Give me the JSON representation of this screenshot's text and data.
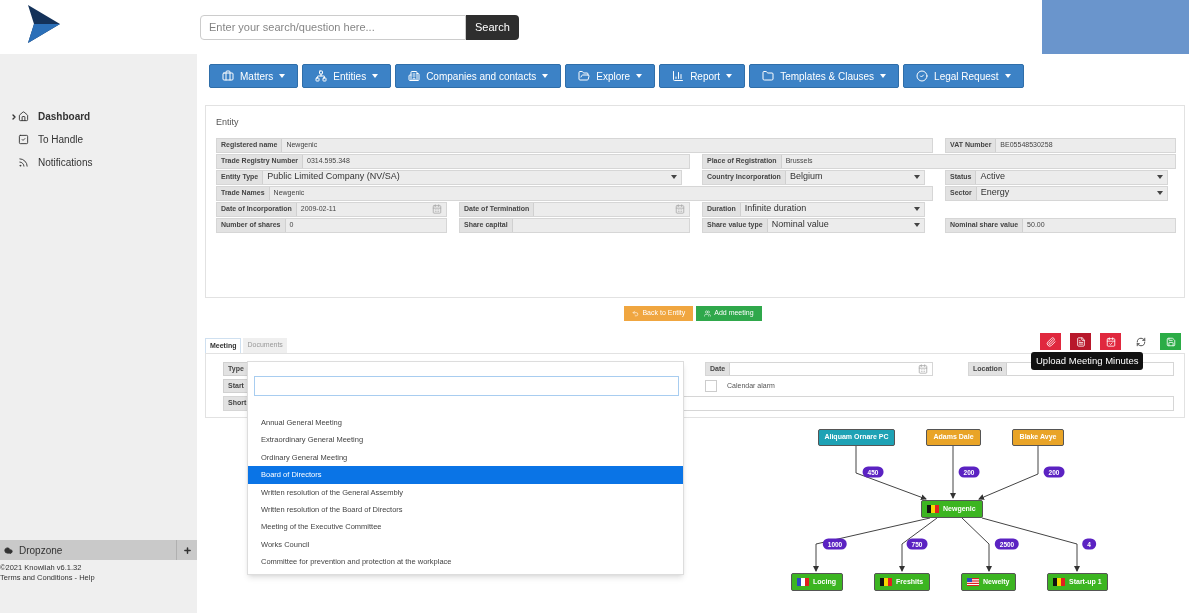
{
  "header": {
    "search": {
      "placeholder": "Enter your search/question here..."
    },
    "search_button": "Search"
  },
  "sidebar": {
    "items": [
      {
        "label": "Dashboard",
        "selected": true
      },
      {
        "label": "To Handle",
        "selected": false
      },
      {
        "label": "Notifications",
        "selected": false
      }
    ],
    "dropzone": "Dropzone",
    "footer": [
      "©2021 Knowliah v6.1.32",
      "Terms and Conditions - Help"
    ]
  },
  "nav": [
    "Matters",
    "Entities",
    "Companies and contacts",
    "Explore",
    "Report",
    "Templates & Clauses",
    "Legal Request"
  ],
  "entity": {
    "title": "Entity",
    "fields": [
      {
        "label": "Registered name",
        "value": "Newgenic",
        "kind": "text"
      },
      {
        "label": "VAT Number",
        "value": "BE05548530258",
        "kind": "text"
      },
      {
        "label": "Trade Registry Number",
        "value": "0314.595.348",
        "kind": "text"
      },
      {
        "label": "Place of Registration",
        "value": "Brussels",
        "kind": "text"
      },
      {
        "label": "Entity Type",
        "value": "Public Limited Company (NV/SA)",
        "kind": "select"
      },
      {
        "label": "Country Incorporation",
        "value": "Belgium",
        "kind": "select"
      },
      {
        "label": "Status",
        "value": "Active",
        "kind": "select"
      },
      {
        "label": "Trade Names",
        "value": "Newgenic",
        "kind": "text"
      },
      {
        "label": "Sector",
        "value": "Energy",
        "kind": "select"
      },
      {
        "label": "Date of Incorporation",
        "value": "2009-02-11",
        "kind": "date"
      },
      {
        "label": "Date of Termination",
        "kind": "date"
      },
      {
        "label": "Duration",
        "value": "Infinite duration",
        "kind": "select"
      },
      {
        "label": "Number of shares",
        "value": "0",
        "kind": "text"
      },
      {
        "label": "Share capital",
        "kind": "text"
      },
      {
        "label": "Share value type",
        "value": "Nominal value",
        "kind": "select"
      },
      {
        "label": "Nominal share value",
        "value": "50.00",
        "kind": "text"
      }
    ]
  },
  "actions": [
    {
      "label": "Back to Entity",
      "kind": "back"
    },
    {
      "label": "Add meeting",
      "kind": "add"
    }
  ],
  "tabs": [
    {
      "label": "Meeting",
      "selected": true
    },
    {
      "label": "Documents",
      "selected": false
    }
  ],
  "toolbar": [
    {
      "kind": "attach",
      "hovered": false
    },
    {
      "kind": "minutes",
      "hovered": true
    },
    {
      "kind": "calendar",
      "hovered": false
    },
    {
      "kind": "refresh",
      "hovered": false
    },
    {
      "kind": "save",
      "hovered": false
    }
  ],
  "tooltip": "Upload Meeting Minutes",
  "meeting_form": {
    "type_label": "Type",
    "start_label": "Start",
    "short_label": "Short",
    "date_label": "Date",
    "location_label": "Location",
    "calendar_alarm": {
      "label": "Calendar alarm",
      "checked": false
    }
  },
  "dropdown": {
    "items": [
      {
        "label": "Annual General Meeting",
        "selected": false
      },
      {
        "label": "Extraordinary General Meeting",
        "selected": false
      },
      {
        "label": "Ordinary General Meeting",
        "selected": false
      },
      {
        "label": "Board of Directors",
        "selected": true
      },
      {
        "label": "Written resolution of the General Assembly",
        "selected": false
      },
      {
        "label": "Written resolution of the Board of Directors",
        "selected": false
      },
      {
        "label": "Meeting of the Executive Committee",
        "selected": false
      },
      {
        "label": "Works Council",
        "selected": false
      },
      {
        "label": "Committee for prevention and protection at the workplace",
        "selected": false
      }
    ]
  },
  "graph": {
    "nodes": [
      {
        "label": "Aliquam Ornare PC",
        "color": "#1ea2b5",
        "kind": "plain"
      },
      {
        "label": "Adams Dale",
        "color": "#e9a427",
        "kind": "plain"
      },
      {
        "label": "Blake Avye",
        "color": "#e9a427",
        "kind": "plain"
      },
      {
        "label": "Newgenic",
        "color": "#3cb521",
        "kind": "belgium"
      },
      {
        "label": "Locing",
        "color": "#3cb521",
        "kind": "france"
      },
      {
        "label": "Freshits",
        "color": "#3cb521",
        "kind": "belgium"
      },
      {
        "label": "Newelty",
        "color": "#3cb521",
        "kind": "usa"
      },
      {
        "label": "Start-up 1",
        "color": "#3cb521",
        "kind": "belgium"
      }
    ],
    "edge_labels": [
      "450",
      "200",
      "200",
      "1000",
      "750",
      "2500",
      "4"
    ]
  }
}
